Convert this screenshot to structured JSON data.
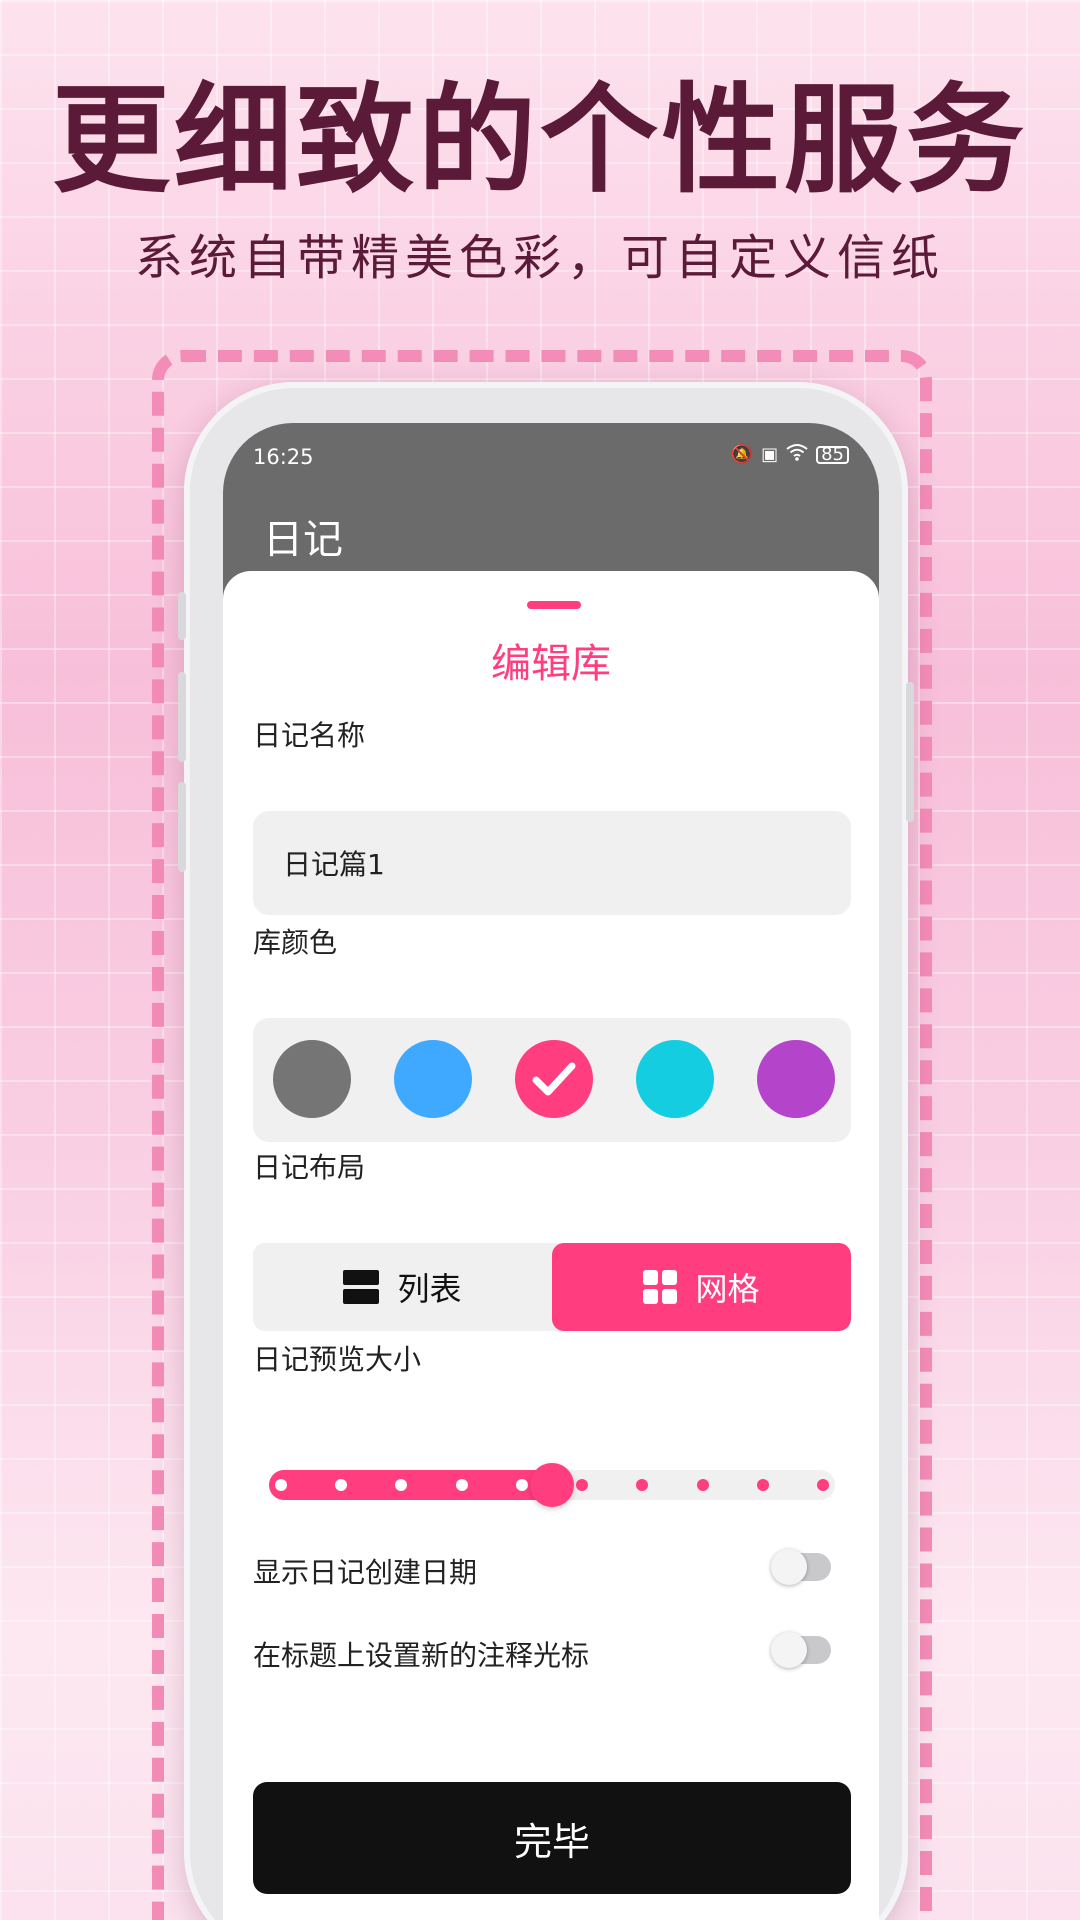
{
  "poster": {
    "headline": "更细致的个性服务",
    "subheadline": "系统自带精美色彩，可自定义信纸"
  },
  "statusbar": {
    "time": "16:25",
    "battery": "85",
    "icons": [
      "bell-off-icon",
      "sim-off-icon",
      "wifi-icon",
      "battery-icon"
    ]
  },
  "appbar": {
    "title": "日记"
  },
  "sheet": {
    "title": "编辑库",
    "name_label": "日记名称",
    "name_value": "日记篇1",
    "color_label": "库颜色",
    "colors": [
      "#757575",
      "#3fa9ff",
      "#ff3d7f",
      "#14cde0",
      "#b444c9"
    ],
    "selected_color": "#ff3d7f",
    "layout_label": "日记布局",
    "layout_options": [
      {
        "label": "列表",
        "icon": "list-icon",
        "selected": false
      },
      {
        "label": "网格",
        "icon": "grid-icon",
        "selected": true
      }
    ],
    "preview_size_label": "日记预览大小",
    "preview_size": {
      "steps": 10,
      "value": 5
    },
    "toggles": [
      {
        "label": "显示日记创建日期",
        "on": false
      },
      {
        "label": "在标题上设置新的注释光标",
        "on": false
      }
    ],
    "done_label": "完毕"
  },
  "accent_color": "#ff3d7f"
}
